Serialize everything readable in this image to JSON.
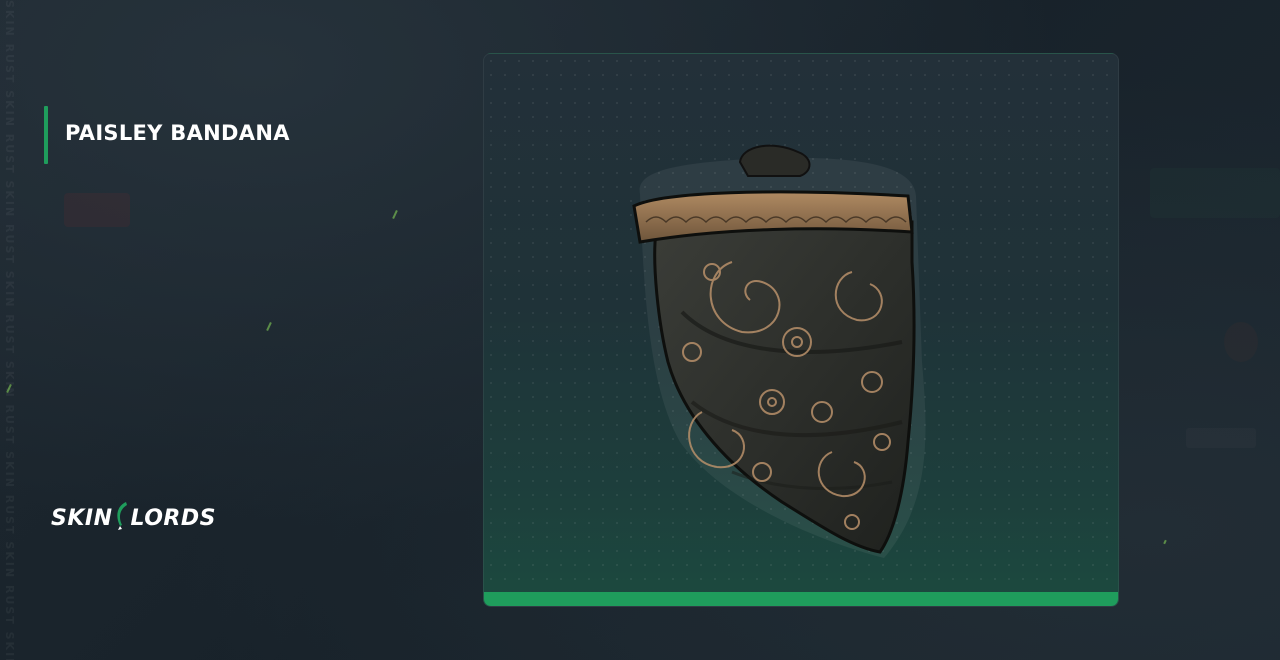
{
  "item": {
    "title": "PAISLEY BANDANA"
  },
  "brand": {
    "logo_left": "SKIN",
    "logo_right": "LORDS"
  },
  "watermark": {
    "text": "SKIN RUST SKIN RUST SKIN RUST SKIN RUST SKIN RUST SKIN RUST SKIN RUST SKIN RUST"
  },
  "colors": {
    "accent": "#1f9d5c",
    "background": "#1b252d",
    "title": "#ffffff"
  },
  "icons": {
    "logo_mark": "sickle-icon",
    "item_image": "bandana-item"
  }
}
